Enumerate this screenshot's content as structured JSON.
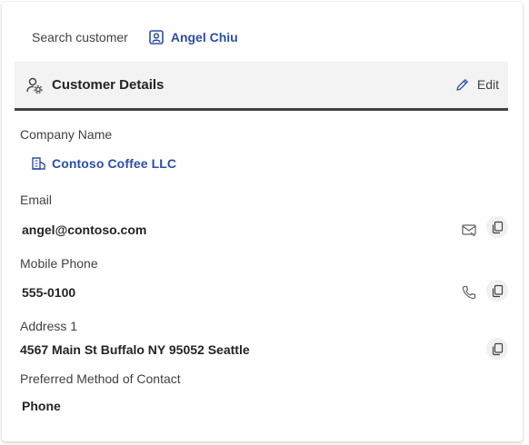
{
  "search": {
    "label": "Search customer",
    "customer_name": "Angel Chiu",
    "customer_icon": "contact-card-icon"
  },
  "section": {
    "title": "Customer Details",
    "icon": "person-settings-icon",
    "edit_label": "Edit",
    "edit_icon": "pencil-icon"
  },
  "fields": {
    "company": {
      "label": "Company Name",
      "value": "Contoso Coffee LLC",
      "icon": "building-icon"
    },
    "email": {
      "label": "Email",
      "value": "angel@contoso.com",
      "action_icon": "send-mail-icon",
      "copy_icon": "copy-icon"
    },
    "phone": {
      "label": "Mobile Phone",
      "value": "555-0100",
      "action_icon": "phone-call-icon",
      "copy_icon": "copy-icon"
    },
    "address": {
      "label": "Address 1",
      "value": "4567 Main St Buffalo NY 95052 Seattle",
      "copy_icon": "copy-icon"
    },
    "contact_method": {
      "label": "Preferred Method of Contact",
      "value": "Phone"
    }
  },
  "colors": {
    "link": "#2b4fa8",
    "header_bg": "#f3f3f3",
    "header_border": "#424242",
    "copy_bg": "#f0f0f0"
  }
}
